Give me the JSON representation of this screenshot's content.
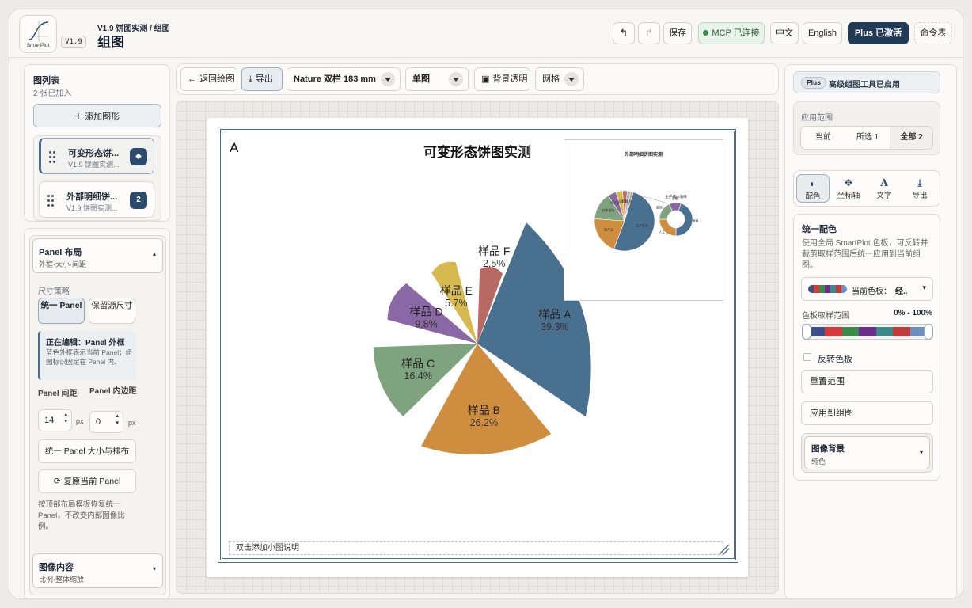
{
  "header": {
    "logo_text": "SmartPlot",
    "version": "V1.9",
    "breadcrumb": "V1.9 饼图实测 / 组图",
    "title": "组图",
    "save_label": "保存",
    "mcp_label": "MCP 已连接",
    "lang_zh": "中文",
    "lang_en": "English",
    "plus_label": "Plus 已激活",
    "command_label": "命令表"
  },
  "left": {
    "list_title": "图列表",
    "list_count": "2 张已加入",
    "add_label": "添加图形",
    "figures": [
      {
        "title": "可变形态饼...",
        "sub": "V1.9 饼图实测...",
        "badge": "◆"
      },
      {
        "title": "外部明细饼...",
        "sub": "V1.9 饼图实测...",
        "badge": "2"
      }
    ],
    "layout": {
      "title": "Panel 布局",
      "sub": "外框·大小·间距",
      "size_strategy": "尺寸策略",
      "opt_uniform": "统一 Panel",
      "opt_keep": "保留源尺寸",
      "editing_title": "正在编辑：Panel 外框",
      "editing_desc": "蓝色外框表示当前 Panel；组图标识固定在 Panel 内。",
      "gap_label": "Panel 间距",
      "padding_label": "Panel 内边距",
      "gap_value": "14",
      "padding_value": "0",
      "unit": "px",
      "unify_btn": "统一 Panel 大小与排布",
      "restore_btn": "复原当前 Panel",
      "restore_desc": "按顶部布局模板恢复统一 Panel，不改变内部图像比例。"
    },
    "image_content": {
      "title": "图像内容",
      "sub": "比例·整体缩放"
    }
  },
  "toolbar": {
    "back_label": "返回绘图",
    "export_label": "导出",
    "preset": "Nature 双栏 183 mm",
    "mode": "单图",
    "transparent_label": "背景透明",
    "grid_label": "网格"
  },
  "canvas": {
    "panel_label": "A",
    "caption_placeholder": "双击添加小图说明"
  },
  "chart_data": [
    {
      "type": "pie",
      "title": "可变形态饼图实测",
      "categories": [
        "样品 A",
        "样品 B",
        "样品 C",
        "样品 D",
        "样品 E",
        "样品 F"
      ],
      "values": [
        39.3,
        26.2,
        16.4,
        9.8,
        5.7,
        2.5
      ],
      "labels": [
        "39.3%",
        "26.2%",
        "16.4%",
        "9.8%",
        "5.7%",
        "2.5%"
      ],
      "colors": [
        "#4a7090",
        "#cf8d3f",
        "#7fa37f",
        "#8a68a5",
        "#d6b94f",
        "#b76a64"
      ]
    },
    {
      "type": "pie",
      "title": "外部明细饼图实测",
      "categories": [
        "生产成本",
        "副产品",
        "技术服务",
        "维护支持",
        "运输",
        "包装",
        "检测",
        "其他"
      ],
      "values": [
        51.0,
        20.3,
        14.8,
        4.5,
        3.6,
        2.5,
        1.8,
        1.5
      ],
      "secondary_title": "生产成本明细",
      "secondary_categories": [
        "原料",
        "人工",
        "能耗",
        "设备"
      ],
      "secondary_values": [
        45.2,
        25.0,
        18.4,
        11.4
      ],
      "colors": [
        "#4a7090",
        "#cf8d3f",
        "#7fa37f",
        "#8a68a5",
        "#d6b94f",
        "#b76a64",
        "#9bb4c9",
        "#c7a98a"
      ]
    }
  ],
  "right": {
    "plus_tag": "Plus",
    "plus_status": "高级组图工具已启用",
    "scope_title": "应用范围",
    "scope_options": [
      "当前",
      "所选 1",
      "全部 2"
    ],
    "tabs": [
      {
        "icon": "◐",
        "label": "配色"
      },
      {
        "icon": "✥",
        "label": "坐标轴"
      },
      {
        "icon": "A",
        "label": "文字"
      },
      {
        "icon": "⤓",
        "label": "导出"
      }
    ],
    "palette": {
      "title": "统一配色",
      "desc": "使用全局 SmartPlot 色板，可反转并裁剪取样范围后统一应用到当前组图。",
      "current_label": "当前色板：",
      "current_value": "经..",
      "range_label": "色板取样范围",
      "range_value": "0% - 100%",
      "reverse_label": "反转色板",
      "reset_btn": "重置范围",
      "apply_btn": "应用到组图",
      "bg_title": "图像背景",
      "bg_value": "纯色",
      "swatches": [
        "#3b4f8c",
        "#d63a3a",
        "#3a8a4a",
        "#6b2d8c",
        "#3a8a8a",
        "#c23a3a",
        "#6b8fc2"
      ]
    }
  }
}
